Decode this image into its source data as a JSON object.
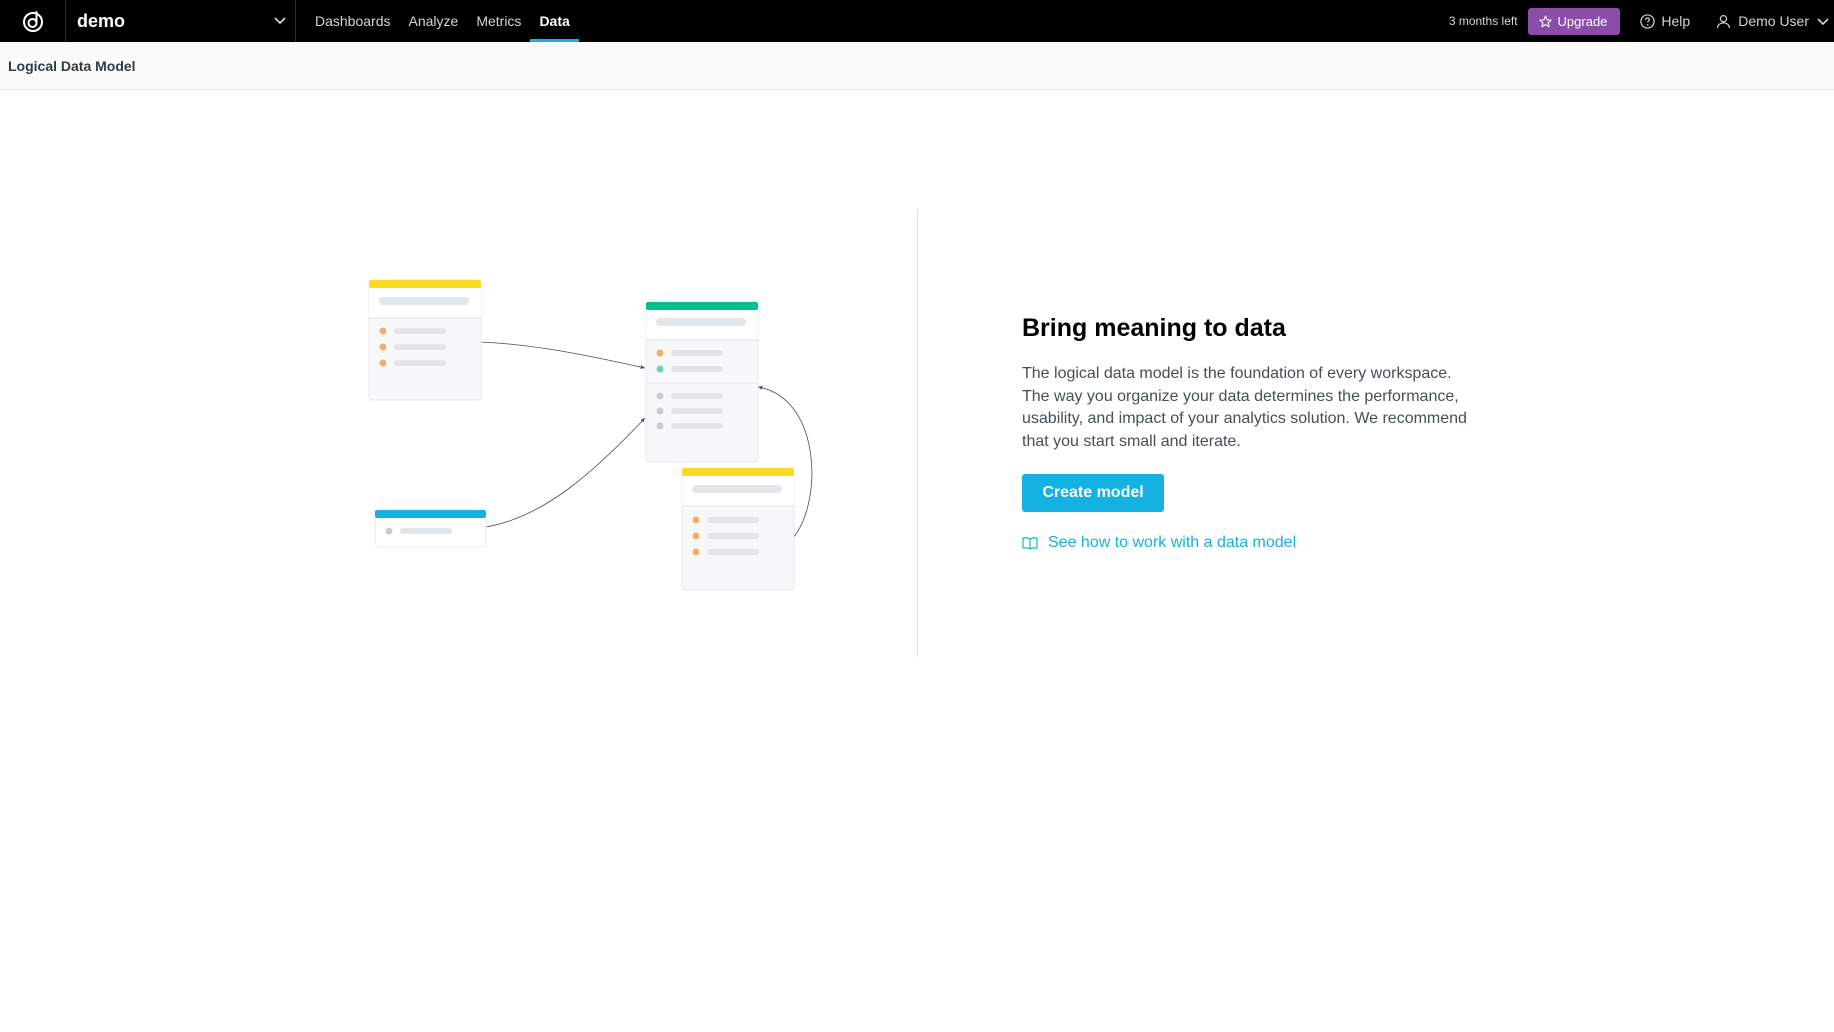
{
  "header": {
    "workspace_name": "demo",
    "nav": [
      {
        "label": "Dashboards",
        "active": false
      },
      {
        "label": "Analyze",
        "active": false
      },
      {
        "label": "Metrics",
        "active": false
      },
      {
        "label": "Data",
        "active": true
      }
    ],
    "trial_text": "3 months left",
    "upgrade_label": "Upgrade",
    "help_label": "Help",
    "user_name": "Demo User"
  },
  "subheader": {
    "title": "Logical Data Model"
  },
  "empty_state": {
    "heading": "Bring meaning to data",
    "description": "The logical data model is the foundation of every workspace. The way you organize your data determines the performance, usability, and impact of your analytics solution. We recommend that you start small and iterate.",
    "create_button_label": "Create model",
    "doc_link_label": "See how to work with a data model"
  },
  "colors": {
    "topbar": "#000000",
    "accent": "#14b2e2",
    "upgrade": "#8a4ea8",
    "dataset_yellow": "#fada23",
    "dataset_green": "#00c18d",
    "dataset_blue": "#14b2e2",
    "dot_orange": "#f2b06e",
    "dot_green": "#6fd4b6",
    "dot_gray": "#c7ccd1"
  },
  "icons": {
    "logo": "gooddata-logo-icon",
    "workspace_chevron": "chevron-down-icon",
    "upgrade": "star-icon",
    "help": "question-circle-icon",
    "user": "user-icon",
    "user_chevron": "chevron-down-icon",
    "doc_link": "book-icon"
  }
}
